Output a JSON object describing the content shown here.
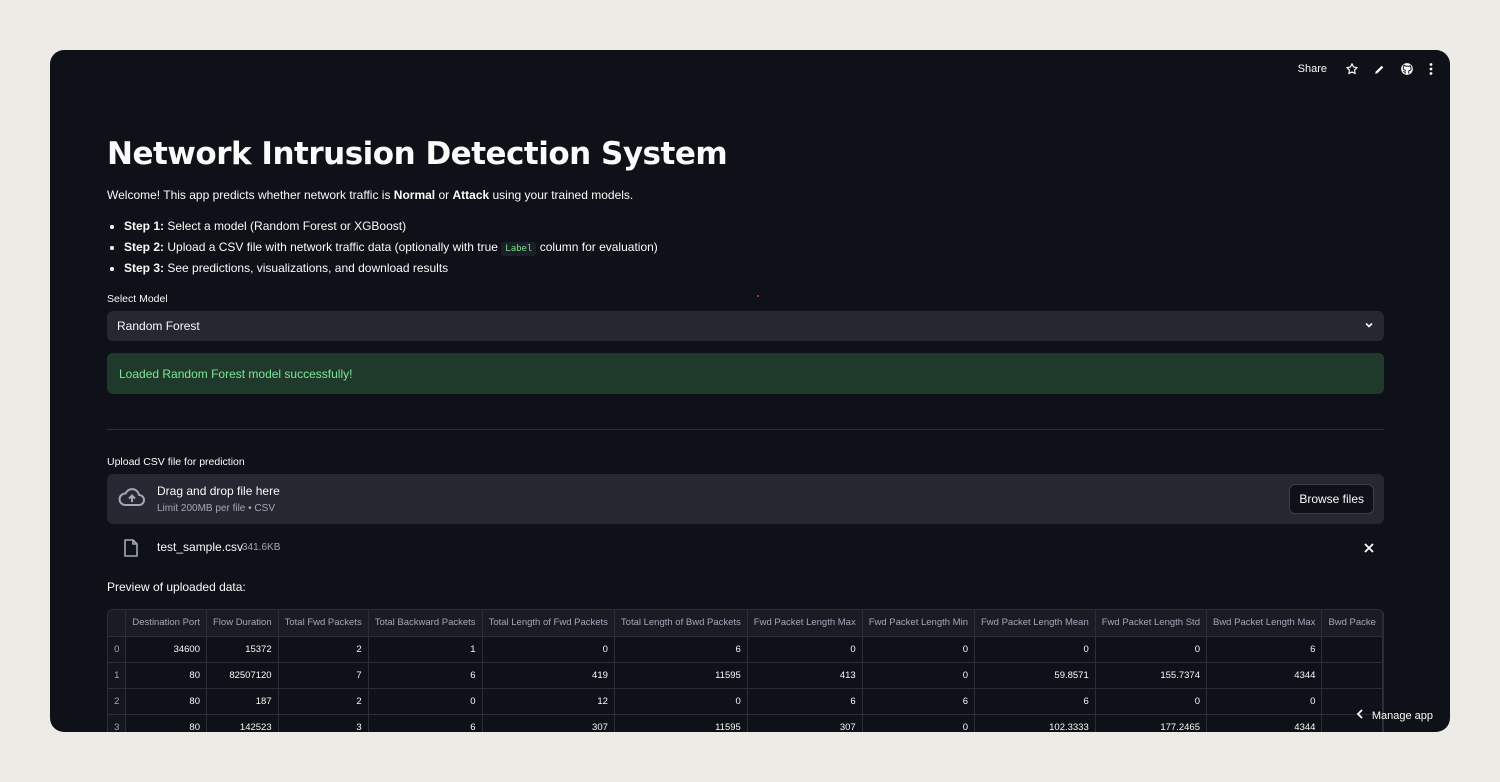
{
  "header": {
    "share_label": "Share",
    "icons": [
      "star-icon",
      "pencil-icon",
      "github-icon",
      "more-vertical-icon"
    ]
  },
  "main": {
    "title": "Network Intrusion Detection System",
    "intro": {
      "pre": "Welcome! This app predicts whether network traffic is ",
      "normal": "Normal",
      "or": " or ",
      "attack": "Attack",
      "post": " using your trained models."
    },
    "steps": [
      {
        "label": "Step 1:",
        "text": " Select a model (Random Forest or XGBoost)"
      },
      {
        "label": "Step 2:",
        "text_pre": " Upload a CSV file with network traffic data (optionally with true ",
        "code": "Label",
        "text_post": " column for evaluation)"
      },
      {
        "label": "Step 3:",
        "text": " See predictions, visualizations, and download results"
      }
    ]
  },
  "model_select": {
    "label": "Select Model",
    "value": "Random Forest"
  },
  "status": {
    "success_message": "Loaded Random Forest model successfully!",
    "success_color": "#7fe59a"
  },
  "uploader": {
    "label": "Upload CSV file for prediction",
    "title": "Drag and drop file here",
    "subtitle": "Limit 200MB per file • CSV",
    "browse_label": "Browse files",
    "file": {
      "name": "test_sample.csv",
      "size": "341.6KB"
    }
  },
  "preview": {
    "label": "Preview of uploaded data:",
    "columns": [
      "",
      "Destination Port",
      "Flow Duration",
      "Total Fwd Packets",
      "Total Backward Packets",
      "Total Length of Fwd Packets",
      "Total Length of Bwd Packets",
      "Fwd Packet Length Max",
      "Fwd Packet Length Min",
      "Fwd Packet Length Mean",
      "Fwd Packet Length Std",
      "Bwd Packet Length Max",
      "Bwd Packe"
    ],
    "rows": [
      [
        "0",
        "34600",
        "15372",
        "2",
        "1",
        "0",
        "6",
        "0",
        "0",
        "0",
        "0",
        "6",
        ""
      ],
      [
        "1",
        "80",
        "82507120",
        "7",
        "6",
        "419",
        "11595",
        "413",
        "0",
        "59.8571",
        "155.7374",
        "4344",
        ""
      ],
      [
        "2",
        "80",
        "187",
        "2",
        "0",
        "12",
        "0",
        "6",
        "6",
        "6",
        "0",
        "0",
        ""
      ],
      [
        "3",
        "80",
        "142523",
        "3",
        "6",
        "307",
        "11595",
        "307",
        "0",
        "102.3333",
        "177.2465",
        "4344",
        ""
      ]
    ]
  },
  "footer": {
    "manage_label": "Manage app"
  }
}
